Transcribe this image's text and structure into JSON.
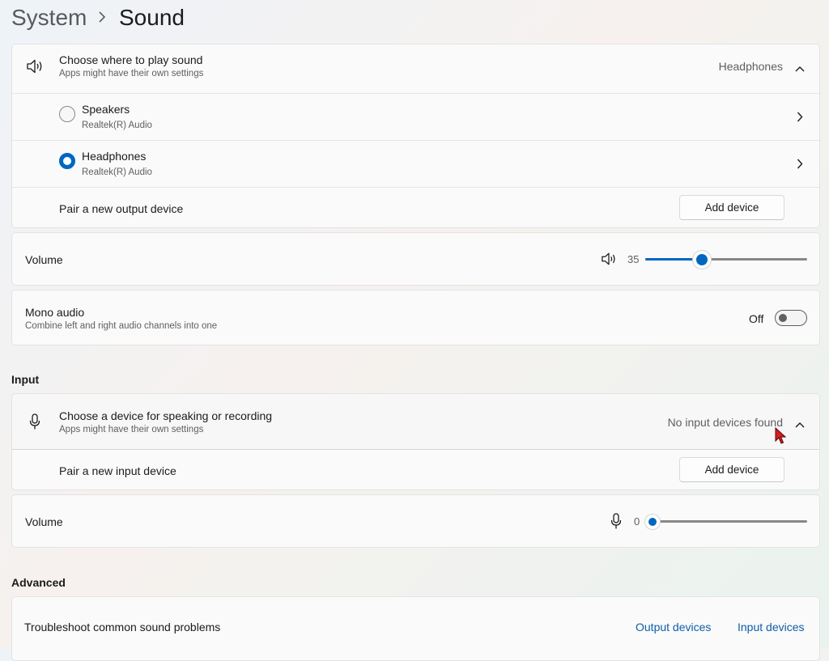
{
  "breadcrumb": {
    "parent": "System",
    "current": "Sound"
  },
  "output": {
    "header_title": "Choose where to play sound",
    "header_sub": "Apps might have their own settings",
    "selected": "Headphones",
    "devices": [
      {
        "name": "Speakers",
        "driver": "Realtek(R) Audio",
        "selected": false
      },
      {
        "name": "Headphones",
        "driver": "Realtek(R) Audio",
        "selected": true
      }
    ],
    "pair_label": "Pair a new output device",
    "add_button": "Add device",
    "volume_label": "Volume",
    "volume_value": "35",
    "volume_fraction": 0.35
  },
  "mono": {
    "title": "Mono audio",
    "sub": "Combine left and right audio channels into one",
    "state": "Off"
  },
  "input": {
    "section": "Input",
    "header_title": "Choose a device for speaking or recording",
    "header_sub": "Apps might have their own settings",
    "status": "No input devices found",
    "pair_label": "Pair a new input device",
    "add_button": "Add device",
    "volume_label": "Volume",
    "volume_value": "0",
    "volume_fraction": 0
  },
  "advanced": {
    "section": "Advanced",
    "troubleshoot_label": "Troubleshoot common sound problems",
    "link_output": "Output devices",
    "link_input": "Input devices"
  },
  "colors": {
    "accent": "#0067c0",
    "link": "#0f5ea8"
  },
  "icons": [
    "chevron-right-icon",
    "speaker-icon",
    "chevron-up-icon",
    "microphone-icon",
    "cursor-icon"
  ]
}
